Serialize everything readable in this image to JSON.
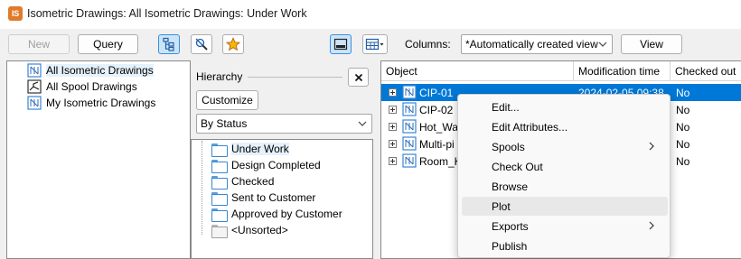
{
  "window": {
    "app_badge": "IS",
    "title": "Isometric Drawings: All Isometric Drawings: Under Work"
  },
  "toolbar": {
    "new_label": "New",
    "query_label": "Query",
    "columns_label": "Columns:",
    "columns_value": "*Automatically created view",
    "view_label": "View"
  },
  "left_tree": {
    "items": [
      {
        "label": "All Isometric Drawings",
        "icon": "iso-drawing-icon"
      },
      {
        "label": "All Spool Drawings",
        "icon": "spool-drawing-icon"
      },
      {
        "label": "My Isometric Drawings",
        "icon": "iso-drawing-icon"
      }
    ]
  },
  "hierarchy": {
    "title": "Hierarchy",
    "customize_label": "Customize",
    "group_by": "By Status",
    "items": [
      {
        "label": "Under Work",
        "icon": "folder-icon"
      },
      {
        "label": "Design Completed",
        "icon": "folder-icon"
      },
      {
        "label": "Checked",
        "icon": "folder-icon"
      },
      {
        "label": "Sent to Customer",
        "icon": "folder-icon"
      },
      {
        "label": "Approved by Customer",
        "icon": "folder-icon"
      },
      {
        "label": "<Unsorted>",
        "icon": "folder-grey-icon"
      }
    ]
  },
  "grid": {
    "columns": [
      "Object",
      "Modification time",
      "Checked out"
    ],
    "rows": [
      {
        "name": "CIP-01",
        "modified": "2024-02-05 09:38",
        "checked_out": "No"
      },
      {
        "name": "CIP-02",
        "modified": "",
        "checked_out": "No"
      },
      {
        "name": "Hot_Wa",
        "modified": "",
        "checked_out": "No"
      },
      {
        "name": "Multi-pi",
        "modified": "",
        "checked_out": "No"
      },
      {
        "name": "Room_K",
        "modified": "",
        "checked_out": "No"
      }
    ]
  },
  "context_menu": {
    "items": [
      {
        "label": "Edit..."
      },
      {
        "label": "Edit Attributes..."
      },
      {
        "label": "Spools"
      },
      {
        "label": "Check Out"
      },
      {
        "label": "Browse"
      },
      {
        "label": "Plot"
      },
      {
        "label": "Exports"
      },
      {
        "label": "Publish"
      }
    ]
  },
  "colors": {
    "selection": "#0078d7",
    "app_badge": "#e07b2b",
    "folder": "#3a86d4"
  }
}
